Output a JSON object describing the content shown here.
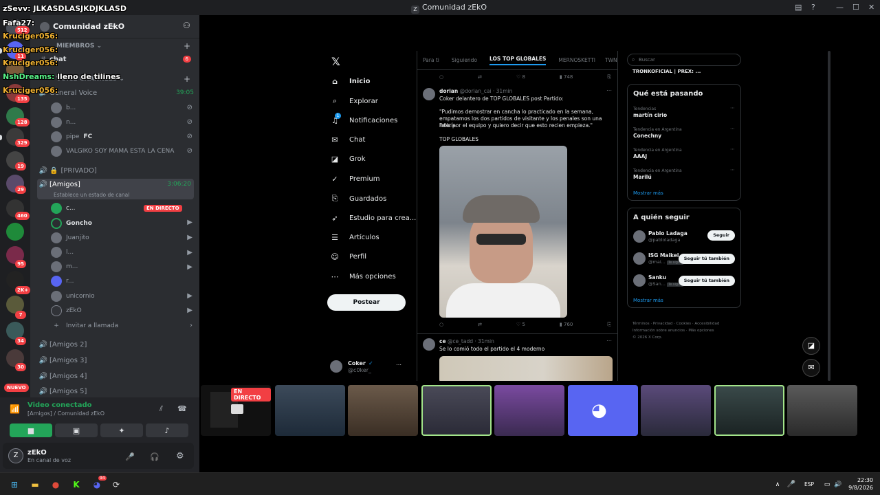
{
  "window": {
    "title": "Comunidad zEkO",
    "logo_letter": "Z"
  },
  "overlay_chat": [
    {
      "user": "zSevv:",
      "message": "JLKASDLASJKDJKLASD",
      "color": "#ffffff"
    },
    {
      "user": "Fafa27:",
      "message": "",
      "color": "#ffffff"
    },
    {
      "user": "Kruciger056:",
      "message": "",
      "color": "#f0b232"
    },
    {
      "user": "Kruciger056:",
      "message": "",
      "color": "#f0b232"
    },
    {
      "user": "Kruciger056:",
      "message": "",
      "color": "#f0b232"
    },
    {
      "user": "NshDreams:",
      "message": "lleno de tilines",
      "color": "#57f287"
    },
    {
      "user": "Kruciger056:",
      "message": "",
      "color": "#f0b232"
    }
  ],
  "guild_badges": [
    "512",
    "11",
    "135",
    "128",
    "329",
    "19",
    "29",
    "460",
    "95",
    "2K+",
    "7",
    "34",
    "30"
  ],
  "guild_new_label": "NUEVO",
  "server": {
    "name": "Comunidad zEkO"
  },
  "sections": {
    "members": "MIEMBROS",
    "voice": "VOICE CHANNELS",
    "members_badge": "6"
  },
  "channels": {
    "chat": "chat",
    "general_voice": "General Voice",
    "general_voice_time": "39:05",
    "general_members": [
      "b...",
      "n...",
      "pipe",
      "VALGIKO SOY MAMA ESTA LA CENA"
    ],
    "pipe_tag": "FC",
    "privado": "[PRIVADO]",
    "amigos": "[Amigos]",
    "amigos_time": "3:06:20",
    "amigos_status": "Establece un estado de canal",
    "live_label": "EN DIRECTO",
    "amigos_members": [
      "c...",
      "Goncho",
      "Juanjito",
      "l...",
      "m...",
      "r...",
      "unicornio",
      "zEkO"
    ],
    "invite": "Invitar a llamada",
    "amigos2": "[Amigos 2]",
    "amigos3": "[Amigos 3]",
    "amigos4": "[Amigos 4]",
    "amigos5": "[Amigos 5]"
  },
  "voice_panel": {
    "status": "Video conectado",
    "sub": "[Amigos] / Comunidad zEkO"
  },
  "user": {
    "name": "zEkO",
    "status": "En canal de voz"
  },
  "x": {
    "nav": [
      "Inicio",
      "Explorar",
      "Notificaciones",
      "Chat",
      "Grok",
      "Premium",
      "Guardados",
      "Estudio para crea...",
      "Artículos",
      "Perfil",
      "Más opciones"
    ],
    "notif_badge": "1",
    "post_label": "Postear",
    "profile": {
      "name": "Coker",
      "handle": "@c0ker_"
    },
    "tabs": [
      "Para ti",
      "Siguiendo",
      "LOS TOP GLOBALES",
      "MERNOSKETTI",
      "TWN"
    ],
    "top_actions": {
      "likes": "8",
      "views": "748"
    },
    "tweet1": {
      "name": "dorian",
      "handle": "@dorian_cai · 31min",
      "line1": "Coker delantero de TOP GLOBALES post Partido:",
      "body": "\"Pudimos demostrar en cancha lo practicado en la semana, empatamos los dos partidos de visitante y los penales son una lotería.",
      "body2": "Feliz por el equipo y quiero decir que esto recien empieza.\"",
      "tag": "TOP GLOBALES",
      "likes": "5",
      "views": "760"
    },
    "tweet2": {
      "name": "ce",
      "handle": "@ce_tadd · 31min",
      "text": "Se lo comió todo el partido el 4 moderno"
    },
    "search_placeholder": "Buscar",
    "top_right_text": "TRONKOFICIAL | PREX: ...",
    "whats_happening": "Qué está pasando",
    "trends": [
      {
        "context": "Tendencias",
        "name": "martín cirio"
      },
      {
        "context": "Tendencia en Argentina",
        "name": "Conechny"
      },
      {
        "context": "Tendencia en Argentina",
        "name": "AAAJ"
      },
      {
        "context": "Tendencia en Argentina",
        "name": "Marilú"
      }
    ],
    "show_more": "Mostrar más",
    "who_to_follow": "A quién seguir",
    "follows": [
      {
        "name": "Pablo Ladaga",
        "handle": "@pabloladaga",
        "button": "Seguir"
      },
      {
        "name": "ISG Maikel",
        "handle": "@mai...",
        "button": "Seguir tú también"
      },
      {
        "name": "Sanku",
        "handle": "@San...",
        "button": "Seguir tú también"
      }
    ],
    "follows_you": "Te sigue",
    "show_more2": "Mostrar más",
    "footer": [
      "Términos",
      "Privacidad",
      "Cookies",
      "Accesibilidad",
      "Información sobre anuncios",
      "Más opciones",
      "© 2026 X Corp."
    ]
  },
  "tiles_live_label": "EN DIRECTO",
  "taskbar": {
    "lang": "ESP",
    "time": "22:30",
    "date": "9/8/2026",
    "discord_badge": "94"
  }
}
